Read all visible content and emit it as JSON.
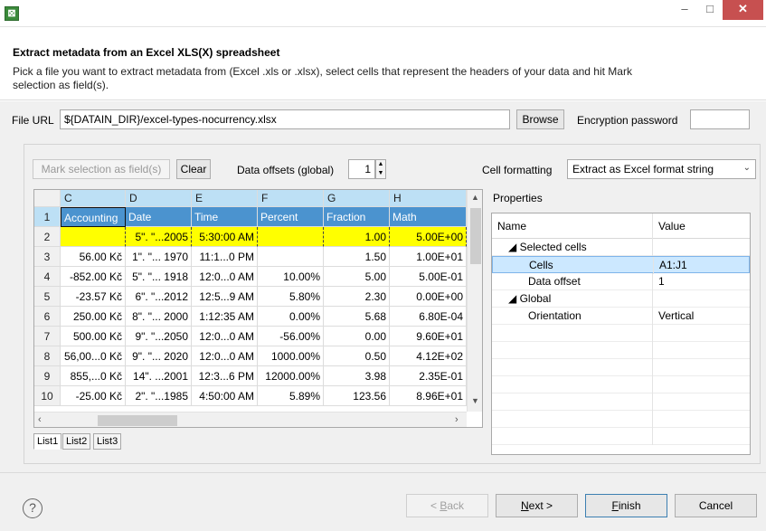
{
  "window": {
    "minimize": "–",
    "maximize": "□",
    "close": "✕",
    "icon_glyph": "⊠"
  },
  "header": {
    "title": "Extract metadata from an Excel XLS(X) spreadsheet",
    "description": "Pick a file you want to extract metadata from (Excel .xls or .xlsx), select cells that represent the headers of your data and hit Mark selection as field(s)."
  },
  "file": {
    "label": "File URL",
    "value": "${DATAIN_DIR}/excel-types-nocurrency.xlsx",
    "browse_label": "Browse",
    "encryption_label": "Encryption password",
    "encryption_value": ""
  },
  "toolbar": {
    "mark_label": "Mark selection as field(s)",
    "clear_label": "Clear",
    "offset_label": "Data offsets (global)",
    "offset_value": "1",
    "formatting_label": "Cell formatting",
    "formatting_value": "Extract as Excel format string"
  },
  "grid": {
    "columns": [
      "C",
      "D",
      "E",
      "F",
      "G",
      "H"
    ],
    "rows": [
      {
        "num": "1",
        "cells": [
          "Accounting",
          "Date",
          "Time",
          "Percent",
          "Fraction",
          "Math"
        ]
      },
      {
        "num": "2",
        "cells": [
          "",
          "5\". \"...2005",
          "5:30:00 AM",
          "",
          "1.00",
          "5.00E+00"
        ]
      },
      {
        "num": "3",
        "cells": [
          "56.00 Kč",
          "1\". \"... 1970",
          "11:1...0 PM",
          "",
          "1.50",
          "1.00E+01"
        ]
      },
      {
        "num": "4",
        "cells": [
          "-852.00 Kč",
          "5\". \"... 1918",
          "12:0...0 AM",
          "10.00%",
          "5.00",
          "5.00E-01"
        ]
      },
      {
        "num": "5",
        "cells": [
          "-23.57 Kč",
          "6\". \"...2012",
          "12:5...9 AM",
          "5.80%",
          "2.30",
          "0.00E+00"
        ]
      },
      {
        "num": "6",
        "cells": [
          "250.00 Kč",
          "8\". \"... 2000",
          "1:12:35 AM",
          "0.00%",
          "5.68",
          "6.80E-04"
        ]
      },
      {
        "num": "7",
        "cells": [
          "500.00 Kč",
          "9\". \"...2050",
          "12:0...0 AM",
          "-56.00%",
          "0.00",
          "9.60E+01"
        ]
      },
      {
        "num": "8",
        "cells": [
          "56,00...0 Kč",
          "9\". \"... 2020",
          "12:0...0 AM",
          "1000.00%",
          "0.50",
          "4.12E+02"
        ]
      },
      {
        "num": "9",
        "cells": [
          "855,...0 Kč",
          "14\". ...2001",
          "12:3...6 PM",
          "12000.00%",
          "3.98",
          "2.35E-01"
        ]
      },
      {
        "num": "10",
        "cells": [
          "-25.00 Kč",
          "2\". \"...1985",
          "4:50:00 AM",
          "5.89%",
          "123.56",
          "8.96E+01"
        ]
      }
    ]
  },
  "sheets": [
    "List1",
    "List2",
    "List3"
  ],
  "properties": {
    "label": "Properties",
    "col_name": "Name",
    "col_value": "Value",
    "rows": [
      {
        "name": "◢ Selected cells",
        "value": ""
      },
      {
        "name": "Cells",
        "value": "A1:J1"
      },
      {
        "name": "Data offset",
        "value": "1"
      },
      {
        "name": "◢ Global",
        "value": ""
      },
      {
        "name": "Orientation",
        "value": "Vertical"
      }
    ]
  },
  "footer": {
    "help": "?",
    "back_pre": "< ",
    "back_key": "B",
    "back_rest": "ack",
    "next_key": "N",
    "next_rest": "ext >",
    "finish_key": "F",
    "finish_rest": "inish",
    "cancel": "Cancel"
  }
}
